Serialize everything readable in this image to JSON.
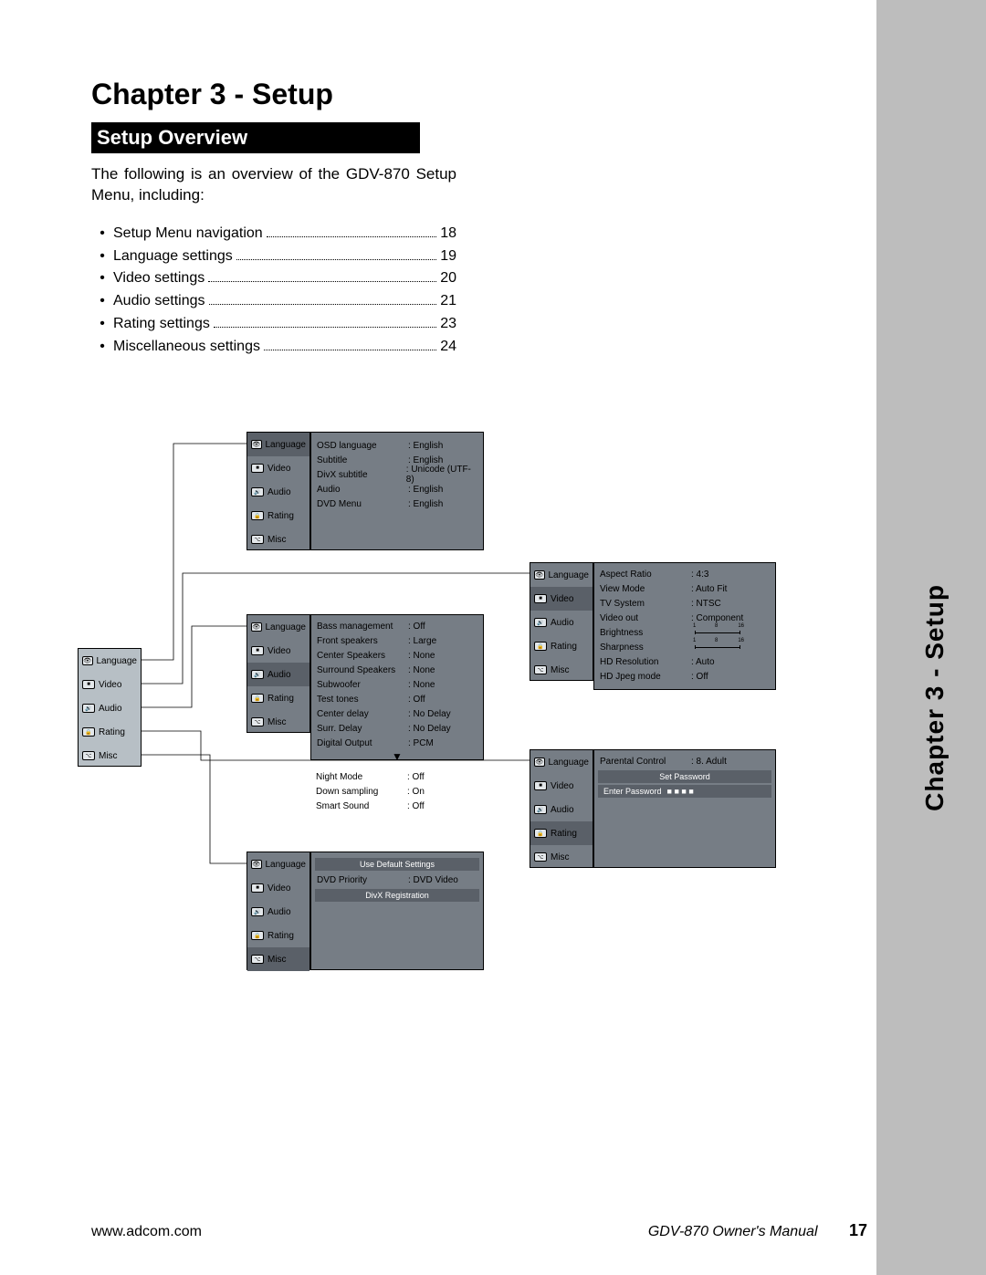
{
  "chapter_title": "Chapter 3 - Setup",
  "section_heading": "Setup Overview",
  "intro_text": "The following is an overview of the GDV-870 Setup Menu, including:",
  "toc": [
    {
      "label": "Setup Menu navigation",
      "page": "18"
    },
    {
      "label": "Language settings",
      "page": "19"
    },
    {
      "label": "Video settings",
      "page": "20"
    },
    {
      "label": "Audio settings",
      "page": "21"
    },
    {
      "label": "Rating settings",
      "page": "23"
    },
    {
      "label": "Miscellaneous settings",
      "page": "24"
    }
  ],
  "sidebar_label": "Chapter 3 - Setup",
  "footer": {
    "url": "www.adcom.com",
    "manual": "GDV-870 Owner's Manual",
    "page_number": "17"
  },
  "menu_items": {
    "language": "Language",
    "video": "Video",
    "audio": "Audio",
    "rating": "Rating",
    "misc": "Misc"
  },
  "panels": {
    "lang_details": [
      {
        "k": "OSD language",
        "v": ": English"
      },
      {
        "k": "Subtitle",
        "v": ": English"
      },
      {
        "k": "DivX subtitle",
        "v": ": Unicode (UTF-8)"
      },
      {
        "k": "Audio",
        "v": ": English"
      },
      {
        "k": "DVD Menu",
        "v": ": English"
      }
    ],
    "video_details": [
      {
        "k": "Aspect Ratio",
        "v": ": 4:3"
      },
      {
        "k": "View Mode",
        "v": ": Auto Fit"
      },
      {
        "k": "TV System",
        "v": ": NTSC"
      },
      {
        "k": "Video out",
        "v": ": Component"
      },
      {
        "k": "Brightness",
        "v": "scale"
      },
      {
        "k": "Sharpness",
        "v": "scale"
      },
      {
        "k": "HD Resolution",
        "v": ": Auto"
      },
      {
        "k": "HD Jpeg mode",
        "v": ": Off"
      }
    ],
    "audio_details": [
      {
        "k": "Bass management",
        "v": ": Off"
      },
      {
        "k": "Front speakers",
        "v": ": Large"
      },
      {
        "k": "Center Speakers",
        "v": ": None"
      },
      {
        "k": "Surround Speakers",
        "v": ": None"
      },
      {
        "k": "Subwoofer",
        "v": ": None"
      },
      {
        "k": "Test tones",
        "v": ": Off"
      },
      {
        "k": "Center delay",
        "v": ": No Delay"
      },
      {
        "k": "Surr. Delay",
        "v": ": No Delay"
      },
      {
        "k": "Digital Output",
        "v": ": PCM"
      }
    ],
    "audio_extra": [
      {
        "k": "Night Mode",
        "v": ": Off"
      },
      {
        "k": "Down sampling",
        "v": ": On"
      },
      {
        "k": "Smart Sound",
        "v": ": Off"
      }
    ],
    "rating_details": {
      "parental_label": "Parental Control",
      "parental_value": ": 8. Adult",
      "set_password": "Set Password",
      "enter_password": "Enter Password",
      "mask": "■ ■ ■ ■"
    },
    "misc_details": {
      "use_default": "Use Default Settings",
      "dvd_priority_k": "DVD Priority",
      "dvd_priority_v": ": DVD Video",
      "divx_reg": "DivX Registration"
    },
    "scale_labels": {
      "a": "1",
      "b": "8",
      "c": "16"
    }
  }
}
